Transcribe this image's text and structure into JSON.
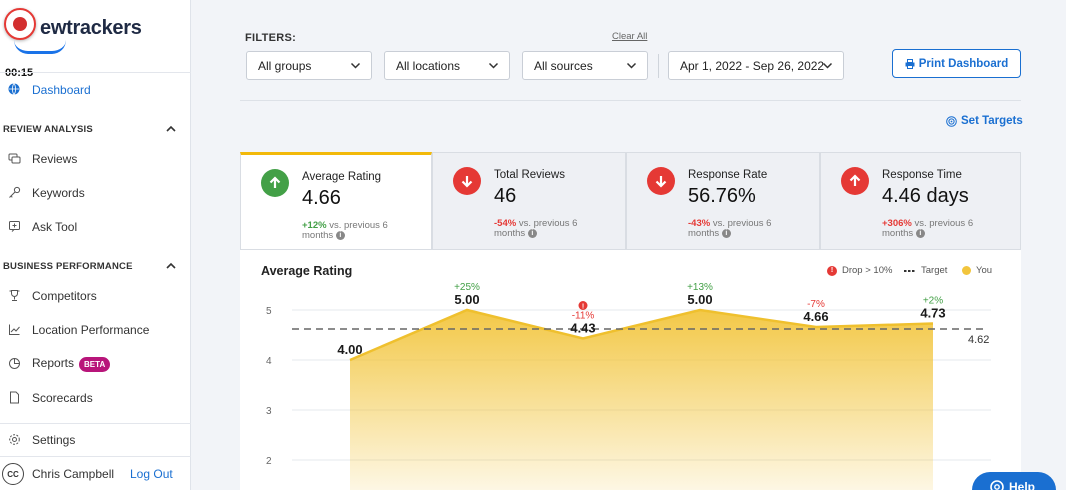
{
  "app": {
    "logo_text": "ewtrackers",
    "timer": "00:15"
  },
  "sidebar": {
    "dashboard": "Dashboard",
    "section_review": "REVIEW ANALYSIS",
    "reviews": "Reviews",
    "keywords": "Keywords",
    "ask_tool": "Ask Tool",
    "section_business": "BUSINESS PERFORMANCE",
    "competitors": "Competitors",
    "location_performance": "Location Performance",
    "reports": "Reports",
    "reports_badge": "BETA",
    "scorecards": "Scorecards",
    "settings": "Settings",
    "user_initials": "CC",
    "user_name": "Chris Campbell",
    "logout": "Log Out"
  },
  "filters": {
    "label": "FILTERS:",
    "clear_all": "Clear All",
    "groups": "All groups",
    "locations": "All locations",
    "sources": "All sources",
    "date_range": "Apr 1, 2022 - Sep 26, 2022",
    "print": "Print Dashboard",
    "set_targets": "Set Targets"
  },
  "kpis": [
    {
      "name": "Average Rating",
      "value": "4.66",
      "change": "+12%",
      "suffix": " vs. previous 6 months"
    },
    {
      "name": "Total Reviews",
      "value": "46",
      "change": "-54%",
      "suffix": " vs. previous 6 months"
    },
    {
      "name": "Response Rate",
      "value": "56.76%",
      "change": "-43%",
      "suffix": " vs. previous 6 months"
    },
    {
      "name": "Response Time",
      "value": "4.46 days",
      "change": "+306%",
      "suffix": " vs. previous 6 months"
    }
  ],
  "chart_panel": {
    "title": "Average Rating",
    "legend_drop": "Drop > 10%",
    "legend_target": "Target",
    "legend_you": "You",
    "help_label": "Help"
  },
  "colors": {
    "accent": "#1a6fd1",
    "area": "#f2c53d",
    "up": "#43a047",
    "down": "#e53935",
    "beta": "#b8157a"
  },
  "chart_data": {
    "type": "area",
    "x": [
      1,
      2,
      3,
      4,
      5,
      6
    ],
    "values": [
      4.0,
      5.0,
      4.43,
      5.0,
      4.66,
      4.73
    ],
    "value_labels": [
      "4.00",
      "5.00",
      "4.43",
      "5.00",
      "4.66",
      "4.73"
    ],
    "changes": [
      "",
      "+25%",
      "-11%",
      "+13%",
      "-7%",
      "+2%"
    ],
    "drops": [
      false,
      false,
      true,
      false,
      false,
      false
    ],
    "target": 4.62,
    "target_label": "4.62",
    "yticks": [
      "5",
      "4",
      "3",
      "2"
    ],
    "ylim": [
      1,
      5.6
    ],
    "grid": true,
    "legend": "top-right"
  }
}
